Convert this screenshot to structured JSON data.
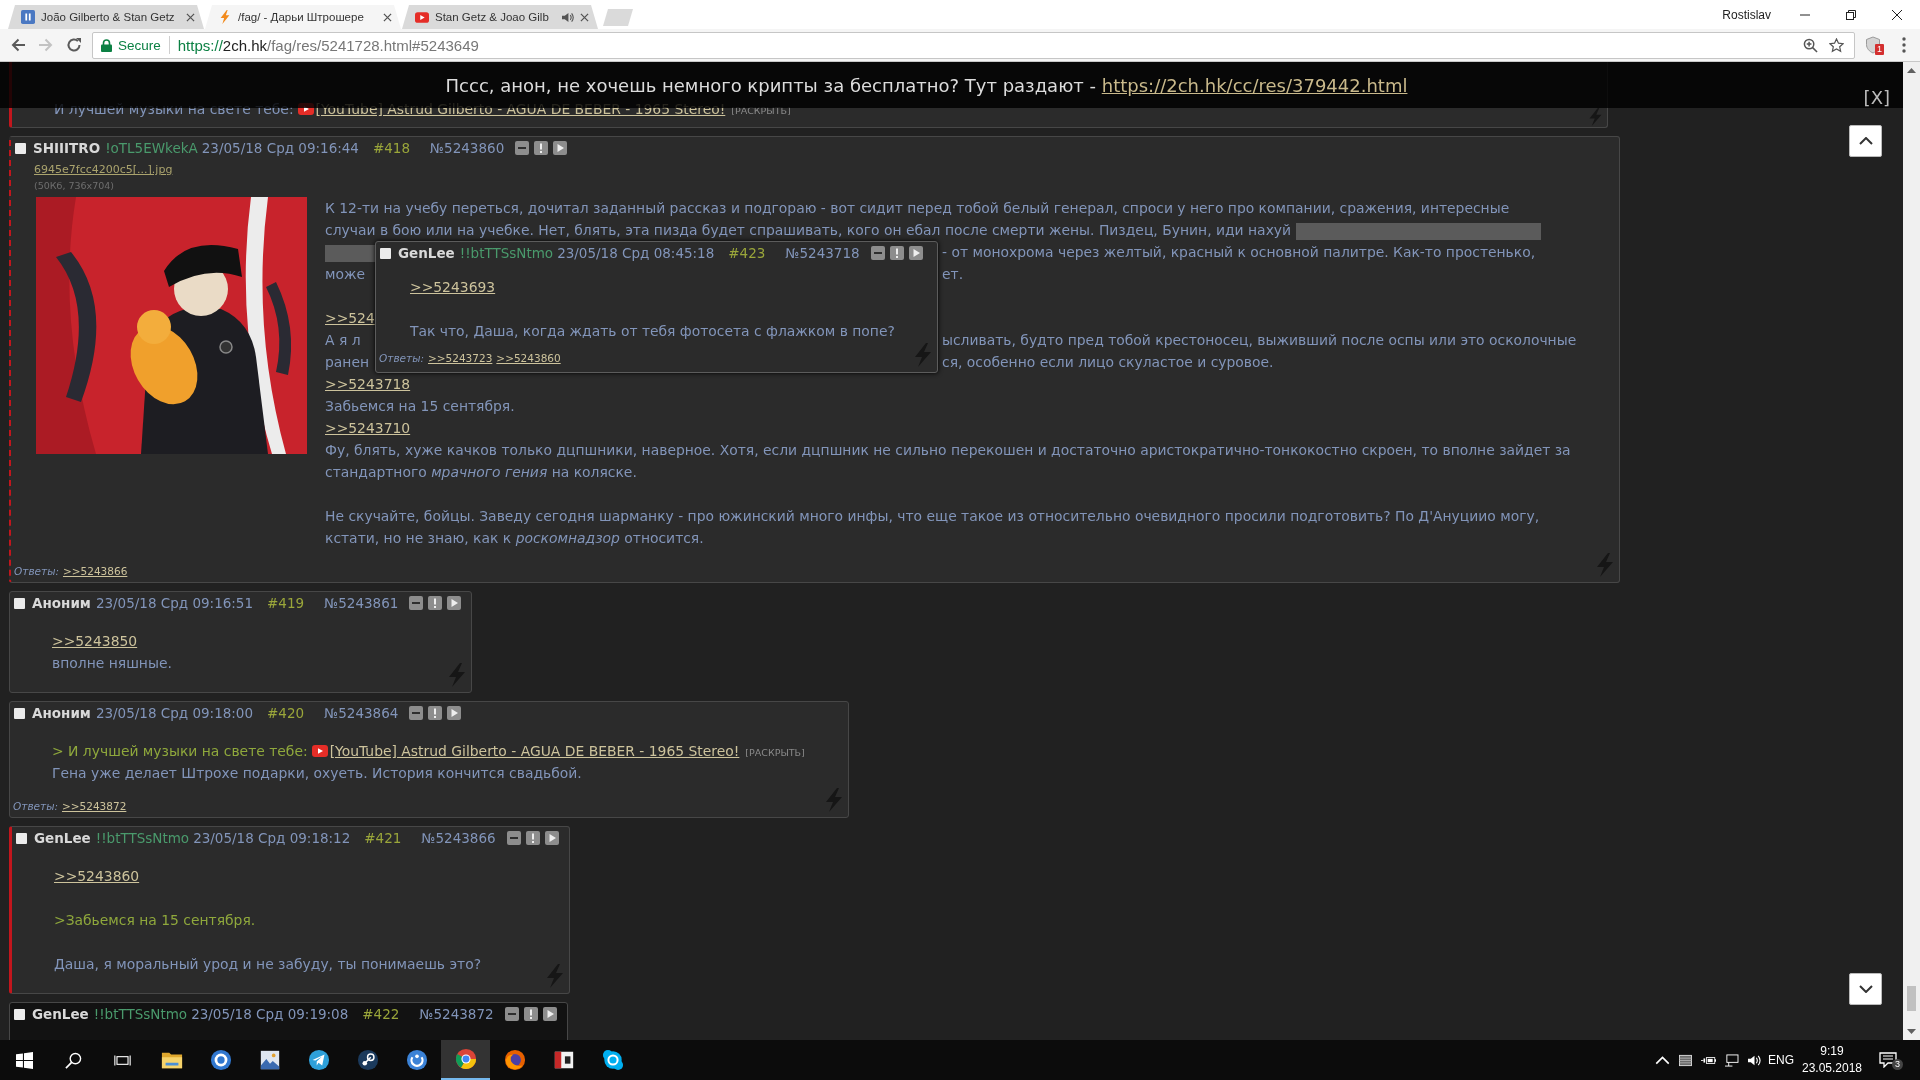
{
  "browser": {
    "tabs": [
      {
        "title": "João Gilberto & Stan Getz",
        "kind": "player",
        "selected": false,
        "audio": false
      },
      {
        "title": "/fag/ - Дарьи Штрошере",
        "kind": "bolt",
        "selected": true,
        "audio": false
      },
      {
        "title": "Stan Getz & Joao Gilb",
        "kind": "youtube",
        "selected": false,
        "audio": true
      }
    ],
    "profile": "Rostislav",
    "back": {
      "disabled": false
    },
    "forward": {
      "disabled": true
    },
    "security": "Secure",
    "url": {
      "scheme": "https://",
      "host": "2ch.hk",
      "path": "/fag/res/5241728.html#5243649"
    },
    "extension_badge": "1"
  },
  "banner": {
    "text": "Пссс, анон, не хочешь немного крипты за бесплатно? Тут раздают -",
    "link": "https://2ch.hk/cc/res/379442.html",
    "close": "[X]"
  },
  "thread": {
    "posts": [
      {
        "kind": "fragment",
        "marked": true,
        "dashed": false,
        "dark": false,
        "lines": [
          {
            "kind": "line",
            "parts": [
              {
                "kind": "text",
                "text": "И лучшей музыки на свете тебе:"
              },
              {
                "kind": "youtube",
                "text": "[YouTube] Astrud Gilberto - AGUA DE BEBER - 1965 Stereo!"
              },
              {
                "kind": "expand",
                "text": "[РАСКРЫТЬ]"
              }
            ]
          }
        ]
      },
      {
        "kind": "post",
        "marked": true,
        "dashed": true,
        "dark": false,
        "checked": false,
        "name": "SHIIITRO",
        "trip": "!oTL5EWkekA",
        "date": "23/05/18 Срд 09:16:44",
        "number": "#418",
        "post_id": "№5243860",
        "file": {
          "name": "6945e7fcc4200c5[...].jpg",
          "info": "(50Кб, 736x704)"
        },
        "lines": [
          {
            "kind": "line",
            "parts": [
              {
                "kind": "text",
                "text": "К 12-ти на учебу переться, дочитал заданный рассказ и подгораю - вот сидит перед тобой белый генерал, спроси у него про компании, сражения, интересные"
              }
            ]
          },
          {
            "kind": "line",
            "parts": [
              {
                "kind": "text",
                "text": "случаи в бою или на учебке. Нет, блять, эта пизда будет спрашивать, кого он ебал после смерти жены. Пиздец, Бунин, иди нахуй"
              },
              {
                "kind": "spoiler"
              }
            ]
          },
          {
            "kind": "split",
            "left": [
              {
                "kind": "spoiler"
              }
            ],
            "right": [
              {
                "kind": "text",
                "text": "- от монохрома через желтый, красный к основной палитре. Как-то простенько,"
              }
            ]
          },
          {
            "kind": "split",
            "left": [
              {
                "kind": "text",
                "text": "може"
              }
            ],
            "right": [
              {
                "kind": "text",
                "text": "ет."
              }
            ]
          },
          {
            "kind": "break"
          },
          {
            "kind": "split",
            "left": [
              {
                "kind": "reply",
                "text": ">>524"
              }
            ]
          },
          {
            "kind": "split",
            "left": [
              {
                "kind": "text",
                "text": "А я л"
              }
            ],
            "right": [
              {
                "kind": "text",
                "text": "ысливать, будто пред тобой крестоносец, выживший после оспы или это осколочные"
              }
            ]
          },
          {
            "kind": "split",
            "left": [
              {
                "kind": "text",
                "text": "ранен"
              }
            ],
            "right": [
              {
                "kind": "text",
                "text": "ся, особенно если лицо скуластое и суровое."
              }
            ]
          },
          {
            "kind": "line",
            "parts": [
              {
                "kind": "reply",
                "text": ">>5243718"
              }
            ]
          },
          {
            "kind": "line",
            "parts": [
              {
                "kind": "text",
                "text": "Забьемся на 15 сентября."
              }
            ]
          },
          {
            "kind": "line",
            "parts": [
              {
                "kind": "reply",
                "text": ">>5243710"
              }
            ]
          },
          {
            "kind": "line",
            "parts": [
              {
                "kind": "text",
                "text": "Фу, блять, хуже качков только дцпшники, наверное. Хотя, если дцпшник не сильно перекошен и достаточно аристократично-тонкокостно скроен, то вполне зайдет за"
              }
            ]
          },
          {
            "kind": "line",
            "parts": [
              {
                "kind": "text",
                "text": "стандартного *мрачного гения* на коляске."
              }
            ]
          },
          {
            "kind": "break"
          },
          {
            "kind": "line",
            "parts": [
              {
                "kind": "text",
                "text": "Не скучайте, бойцы. Заведу сегодня шарманку - про южинский много инфы, что еще такое из относительно очевидного просили подготовить? По Д'Ануциио могу,"
              }
            ]
          },
          {
            "kind": "line",
            "parts": [
              {
                "kind": "text",
                "text": "кстати, но не знаю, как к *роскомнадзор* относится."
              }
            ]
          }
        ],
        "preview": {
          "checked": false,
          "name": "GenLee",
          "trip": "!!btTTSsNtmo",
          "date": "23/05/18 Срд 08:45:18",
          "number": "#423",
          "post_id": "№5243718",
          "lines": [
            {
              "kind": "line",
              "parts": [
                {
                  "kind": "reply",
                  "text": ">>5243693"
                }
              ]
            },
            {
              "kind": "break"
            },
            {
              "kind": "line",
              "parts": [
                {
                  "kind": "text",
                  "text": "Так что, Даша, когда ждать от тебя фотосета с флажком в попе?"
                }
              ]
            }
          ],
          "replies_label": "Ответы:",
          "replies": [
            ">>5243723",
            ">>5243860"
          ]
        },
        "replies_label": "Ответы:",
        "replies": [
          ">>5243866"
        ]
      },
      {
        "kind": "post",
        "marked": false,
        "dashed": false,
        "dark": false,
        "checked": false,
        "name": "Аноним",
        "date": "23/05/18 Срд 09:16:51",
        "number": "#419",
        "post_id": "№5243861",
        "lines": [
          {
            "kind": "line",
            "parts": [
              {
                "kind": "reply",
                "text": ">>5243850"
              }
            ]
          },
          {
            "kind": "line",
            "parts": [
              {
                "kind": "text",
                "text": "вполне няшные."
              }
            ]
          }
        ]
      },
      {
        "kind": "post",
        "marked": false,
        "dashed": false,
        "dark": false,
        "checked": false,
        "name": "Аноним",
        "date": "23/05/18 Срд 09:18:00",
        "number": "#420",
        "post_id": "№5243864",
        "lines": [
          {
            "kind": "line",
            "parts": [
              {
                "kind": "quote",
                "text": "> И лучшей музыки на свете тебе:"
              },
              {
                "kind": "youtube",
                "text": "[YouTube] Astrud Gilberto - AGUA DE BEBER - 1965 Stereo!"
              },
              {
                "kind": "expand",
                "text": "[РАСКРЫТЬ]"
              }
            ]
          },
          {
            "kind": "line",
            "parts": [
              {
                "kind": "text",
                "text": "Гена уже делает Штрохе подарки, охуеть. История кончится свадьбой."
              }
            ]
          }
        ],
        "replies_label": "Ответы:",
        "replies": [
          ">>5243872"
        ]
      },
      {
        "kind": "post",
        "marked": true,
        "dashed": false,
        "dark": false,
        "checked": false,
        "name": "GenLee",
        "trip": "!!btTTSsNtmo",
        "date": "23/05/18 Срд 09:18:12",
        "number": "#421",
        "post_id": "№5243866",
        "lines": [
          {
            "kind": "line",
            "parts": [
              {
                "kind": "reply",
                "text": ">>5243860"
              }
            ]
          },
          {
            "kind": "break"
          },
          {
            "kind": "line",
            "parts": [
              {
                "kind": "quote",
                "text": ">Забьемся на 15 сентября."
              }
            ]
          },
          {
            "kind": "break"
          },
          {
            "kind": "line",
            "parts": [
              {
                "kind": "text",
                "text": "Даша, я моральный урод и не забуду, ты понимаешь это?"
              }
            ]
          }
        ]
      },
      {
        "kind": "post",
        "marked": false,
        "dashed": false,
        "dark": true,
        "checked": false,
        "name": "GenLee",
        "trip": "!!btTTSsNtmo",
        "date": "23/05/18 Срд 09:19:08",
        "number": "#422",
        "post_id": "№5243872"
      }
    ]
  },
  "taskbar": {
    "apps": [
      {
        "kind": "start",
        "selected": false
      },
      {
        "kind": "search",
        "selected": false
      },
      {
        "kind": "taskview",
        "selected": false
      },
      {
        "kind": "folder",
        "selected": false
      },
      {
        "kind": "ring_app",
        "selected": false
      },
      {
        "kind": "picture",
        "selected": false
      },
      {
        "kind": "telegram",
        "selected": false
      },
      {
        "kind": "steam",
        "selected": false
      },
      {
        "kind": "swirl_app",
        "selected": false
      },
      {
        "kind": "chrome",
        "selected": true
      },
      {
        "kind": "firefox",
        "selected": false
      },
      {
        "kind": "card_app",
        "selected": false
      },
      {
        "kind": "skype",
        "selected": false
      }
    ],
    "language": "ENG",
    "time": "9:19",
    "date": "23.05.2018",
    "notifications": "3"
  }
}
